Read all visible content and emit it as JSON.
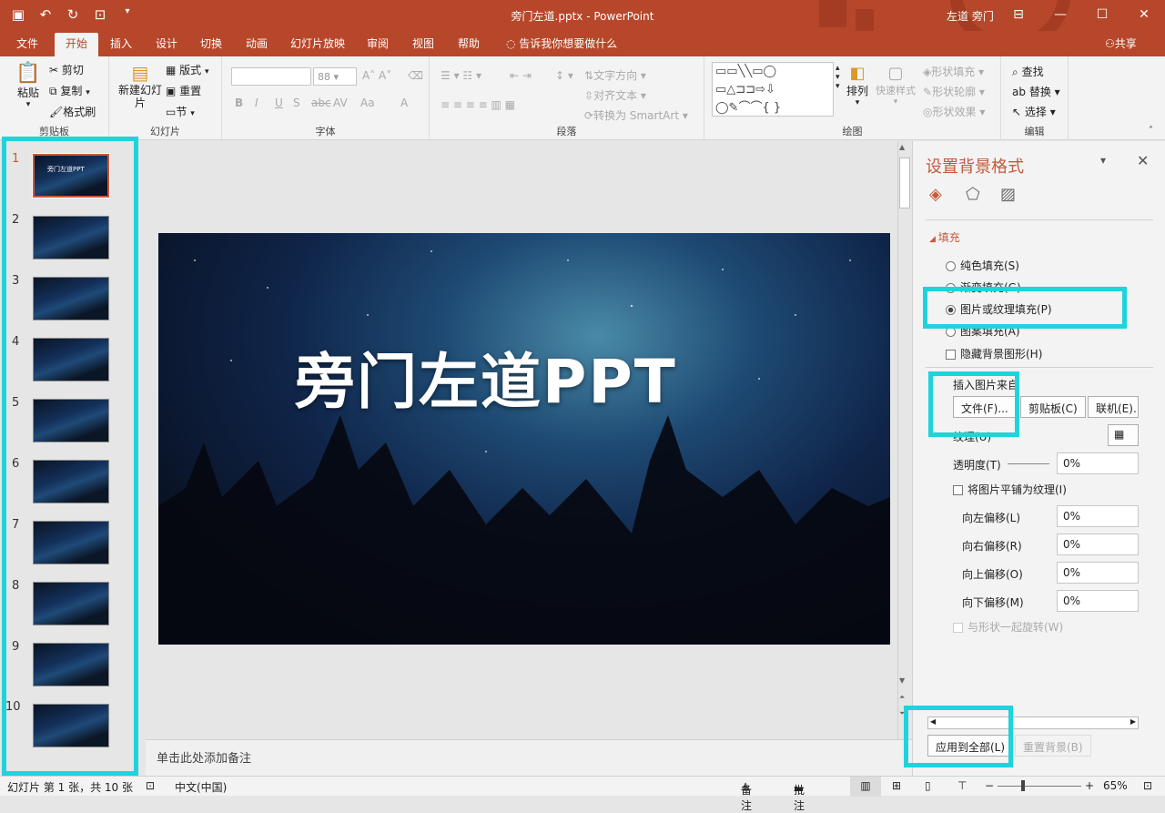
{
  "app": {
    "doc_title": "旁门左道.pptx  -  PowerPoint",
    "user": "左道 旁门"
  },
  "qat": {
    "save_icon": "save-icon",
    "undo_icon": "undo-icon",
    "redo_icon": "redo-icon",
    "present_icon": "present-icon",
    "customize_icon": "customize-icon"
  },
  "tabs": [
    "文件",
    "开始",
    "插入",
    "设计",
    "切换",
    "动画",
    "幻灯片放映",
    "审阅",
    "视图",
    "帮助"
  ],
  "active_tab": "开始",
  "tellme": "告诉我你想要做什么",
  "share": "共享",
  "ribbon": {
    "clipboard": {
      "label": "剪贴板",
      "paste": "粘贴",
      "cut": "剪切",
      "copy": "复制",
      "format_painter": "格式刷"
    },
    "slides": {
      "label": "幻灯片",
      "new_slide": "新建幻灯片",
      "layout": "版式",
      "reset": "重置",
      "section": "节"
    },
    "font": {
      "label": "字体",
      "font_size": "88",
      "bold": "B",
      "italic": "I",
      "underline": "U",
      "strike": "S",
      "spacing": "AV",
      "case": "Aa",
      "color": "A"
    },
    "paragraph": {
      "label": "段落",
      "text_dir": "文字方向",
      "align_text": "对齐文本",
      "smartart": "转换为 SmartArt"
    },
    "drawing": {
      "label": "绘图",
      "arrange": "排列",
      "quick_styles": "快速样式",
      "shape_fill": "形状填充",
      "shape_outline": "形状轮廓",
      "shape_effects": "形状效果"
    },
    "editing": {
      "label": "编辑",
      "find": "查找",
      "replace": "替换",
      "select": "选择"
    }
  },
  "thumbnails": {
    "numbers": [
      "1",
      "2",
      "3",
      "4",
      "5",
      "6",
      "7",
      "8",
      "9",
      "10"
    ],
    "first_title": "旁门左道PPT",
    "selected": 1
  },
  "slide": {
    "title": "旁门左道PPT"
  },
  "notes_placeholder": "单击此处添加备注",
  "pane": {
    "title": "设置背景格式",
    "section": "填充",
    "opt_solid": "纯色填充(S)",
    "opt_gradient": "渐变填充(G)",
    "opt_picture": "图片或纹理填充(P)",
    "opt_pattern": "图案填充(A)",
    "opt_hide": "隐藏背景图形(H)",
    "insert_from": "插入图片来自",
    "btn_file": "文件(F)...",
    "btn_clipboard": "剪贴板(C)",
    "btn_online": "联机(E)...",
    "texture": "纹理(U)",
    "transparency_label": "透明度(T)",
    "transparency": "0%",
    "tile": "将图片平铺为纹理(I)",
    "offset_left_label": "向左偏移(L)",
    "offset_left": "0%",
    "offset_right_label": "向右偏移(R)",
    "offset_right": "0%",
    "offset_top_label": "向上偏移(O)",
    "offset_top": "0%",
    "offset_bottom_label": "向下偏移(M)",
    "offset_bottom": "0%",
    "rotate_with_shape": "与形状一起旋转(W)",
    "apply_all": "应用到全部(L)",
    "reset_bg": "重置背景(B)"
  },
  "status": {
    "slide_info": "幻灯片 第 1 张，共 10 张",
    "language": "中文(中国)",
    "notes": "备注",
    "comments": "批注",
    "zoom": "65%"
  }
}
